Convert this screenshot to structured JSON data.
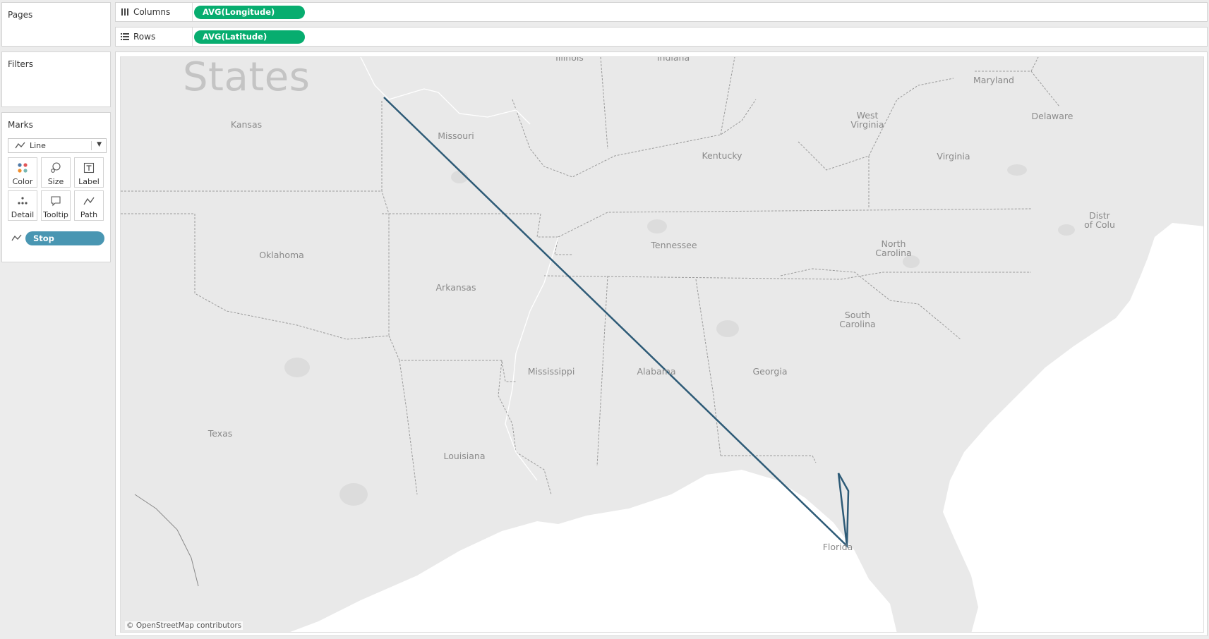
{
  "panels": {
    "pages": {
      "title": "Pages"
    },
    "filters": {
      "title": "Filters"
    },
    "marks": {
      "title": "Marks",
      "mark_type": "Line",
      "buttons": [
        "Color",
        "Size",
        "Label",
        "Detail",
        "Tooltip",
        "Path"
      ],
      "path_field": "Stop"
    }
  },
  "shelves": {
    "columns": {
      "label": "Columns",
      "pill": "AVG(Longitude)"
    },
    "rows": {
      "label": "Rows",
      "pill": "AVG(Latitude)"
    }
  },
  "view": {
    "title": "States",
    "attribution": "© OpenStreetMap contributors",
    "states": [
      "Illinois",
      "Indiana",
      "Maryland",
      "Kansas",
      "Missouri",
      "West\nVirginia",
      "Delaware",
      "Kentucky",
      "Virginia",
      "Distr\nof Colu",
      "Oklahoma",
      "Tennessee",
      "North\nCarolina",
      "Arkansas",
      "South\nCarolina",
      "Mississippi",
      "Alabama",
      "Georgia",
      "Texas",
      "Louisiana",
      "Florida"
    ]
  },
  "colors": {
    "pill_green": "#07ad6f",
    "pill_blue": "#4996b2",
    "path_line": "#2e5b77",
    "land": "#e9e9e9",
    "water": "#ffffff"
  }
}
